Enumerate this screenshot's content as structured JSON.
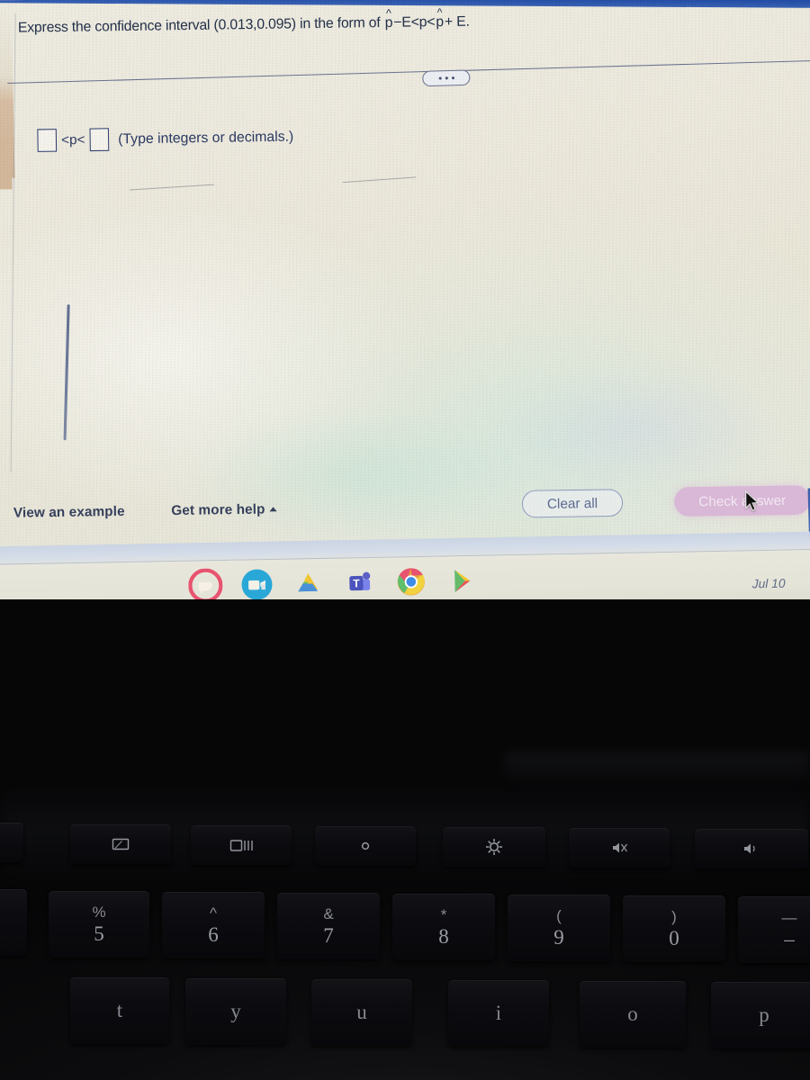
{
  "screen": {
    "question": {
      "prefix": "Express the confidence interval (0.013,0.095) in the form of ",
      "p_hat_1": "p",
      "minus_E": "−E<p<",
      "p_hat_2": "p",
      "plus_E": "+ E."
    },
    "expand_button": "•••",
    "answer": {
      "box1_value": "",
      "box2_value": "",
      "operator_left": "<p<",
      "hint": "(Type integers or decimals.)"
    },
    "toolbar": {
      "view_example": "View an example",
      "get_more_help": "Get more help",
      "clear_all": "Clear all",
      "check_answer": "Check answer"
    }
  },
  "shelf": {
    "date": "Jul 10",
    "icons": [
      {
        "name": "gmail-icon",
        "color": "#e8536f"
      },
      {
        "name": "google-meet-icon",
        "color": "#29a8d8"
      },
      {
        "name": "google-drive-icon",
        "color": "#f3c533"
      },
      {
        "name": "microsoft-teams-icon",
        "color": "#5b5fc7"
      },
      {
        "name": "google-chrome-icon",
        "color": "#3f8ce8"
      },
      {
        "name": "google-play-store-icon",
        "color": "#4fc3f7"
      }
    ]
  },
  "keyboard": {
    "function_keys": [
      {
        "name": "fullscreen-key",
        "glyph": "fullscreen"
      },
      {
        "name": "overview-windows-key",
        "glyph": "overview"
      },
      {
        "name": "brightness-down-key",
        "glyph": "brightness-low"
      },
      {
        "name": "brightness-up-key",
        "glyph": "brightness-high"
      },
      {
        "name": "mute-key",
        "glyph": "mute"
      },
      {
        "name": "volume-down-key",
        "glyph": "volume"
      }
    ],
    "number_keys": [
      {
        "shift": "%",
        "digit": "5"
      },
      {
        "shift": "^",
        "digit": "6"
      },
      {
        "shift": "&",
        "digit": "7"
      },
      {
        "shift": "*",
        "digit": "8"
      },
      {
        "shift": "(",
        "digit": "9"
      },
      {
        "shift": ")",
        "digit": "0"
      },
      {
        "shift": "—",
        "digit": "–"
      }
    ],
    "letter_keys": [
      "t",
      "y",
      "u",
      "i",
      "o",
      "p"
    ]
  },
  "colors": {
    "accent_blue": "#1c47a3",
    "check_button": "#d9b7d6",
    "text_navy": "#2b3a63",
    "screen_bg": "#ece9dc"
  }
}
